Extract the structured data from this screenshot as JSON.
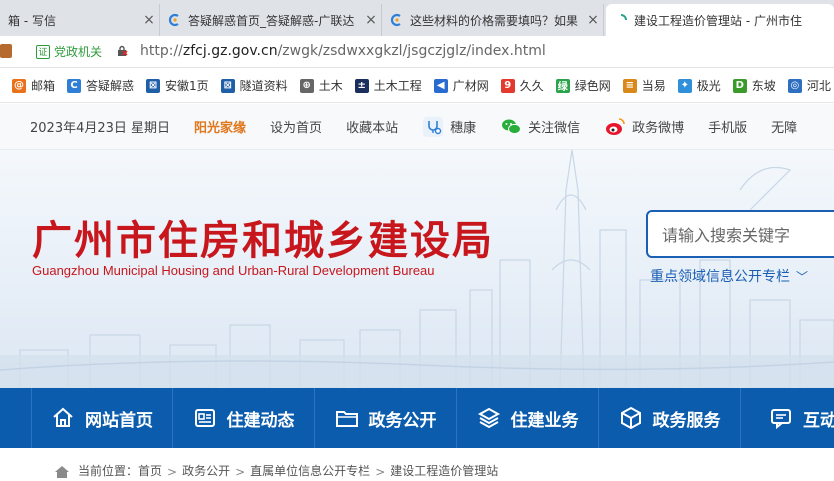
{
  "browser": {
    "tabs": [
      {
        "label": "箱 - 写信",
        "active": false
      },
      {
        "label": "答疑解惑首页_答疑解惑-广联达",
        "active": false
      },
      {
        "label": "这些材料的价格需要填吗？如果",
        "active": false
      },
      {
        "label": "建设工程造价管理站 - 广州市住",
        "active": true
      }
    ],
    "close_glyph": "×",
    "badge": "党政机关",
    "url_prefix": "http://",
    "url_domain": "zfcj.gz.gov.cn",
    "url_path": "/zwgk/zsdwxxgkzl/jsgczjglz/index.html",
    "bookmarks": [
      {
        "label": "邮箱",
        "icon": "mail-icon",
        "color": "#e8711a",
        "glyph": "@"
      },
      {
        "label": "答疑解惑",
        "icon": "glodon-icon",
        "color": "#2f7fd6",
        "glyph": "C"
      },
      {
        "label": "安徽1页",
        "icon": "grid-icon",
        "color": "#1f5fa8",
        "glyph": "⊠"
      },
      {
        "label": "隧道资料",
        "icon": "grid-icon",
        "color": "#1f5fa8",
        "glyph": "⊠"
      },
      {
        "label": "土木",
        "icon": "globe-icon",
        "color": "#666666",
        "glyph": "⊕"
      },
      {
        "label": "土木工程",
        "icon": "plus-box-icon",
        "color": "#1b2f5e",
        "glyph": "±"
      },
      {
        "label": "广材网",
        "icon": "gcw-icon",
        "color": "#2a6bd1",
        "glyph": "◀"
      },
      {
        "label": "久久",
        "icon": "jiujiu-icon",
        "color": "#e23a2f",
        "glyph": "9"
      },
      {
        "label": "绿色网",
        "icon": "green-icon",
        "color": "#2aa34a",
        "glyph": "绿"
      },
      {
        "label": "当易",
        "icon": "dangyi-icon",
        "color": "#d9891a",
        "glyph": "≡"
      },
      {
        "label": "极光",
        "icon": "aurora-icon",
        "color": "#2f8fd8",
        "glyph": "✦"
      },
      {
        "label": "东坡",
        "icon": "dongpo-icon",
        "color": "#3a9a2a",
        "glyph": "D"
      },
      {
        "label": "河北",
        "icon": "hebei-icon",
        "color": "#2f6fc0",
        "glyph": "◎"
      }
    ]
  },
  "utility": {
    "date": "2023年4月23日 星期日",
    "sunshine": "阳光家缘",
    "set_home": "设为首页",
    "bookmark": "收藏本站",
    "suikang": "穗康",
    "wechat": "关注微信",
    "weibo": "政务微博",
    "mobile": "手机版",
    "accessible": "无障"
  },
  "header": {
    "title": "广州市住房和城乡建设局",
    "subtitle": "Guangzhou Municipal Housing and Urban-Rural Development Bureau",
    "search_placeholder": "请输入搜索关键字",
    "focus_link": "重点领域信息公开专栏",
    "brand_color": "#c8161d",
    "nav_color": "#0b5cad"
  },
  "nav": [
    {
      "label": "网站首页",
      "icon": "home-icon"
    },
    {
      "label": "住建动态",
      "icon": "news-icon"
    },
    {
      "label": "政务公开",
      "icon": "folder-icon"
    },
    {
      "label": "住建业务",
      "icon": "layers-icon"
    },
    {
      "label": "政务服务",
      "icon": "cube-icon"
    },
    {
      "label": "互动交",
      "icon": "chat-icon"
    }
  ],
  "breadcrumb": {
    "prefix": "当前位置：",
    "items": [
      "首页",
      "政务公开",
      "直属单位信息公开专栏",
      "建设工程造价管理站"
    ],
    "sep": ">"
  }
}
